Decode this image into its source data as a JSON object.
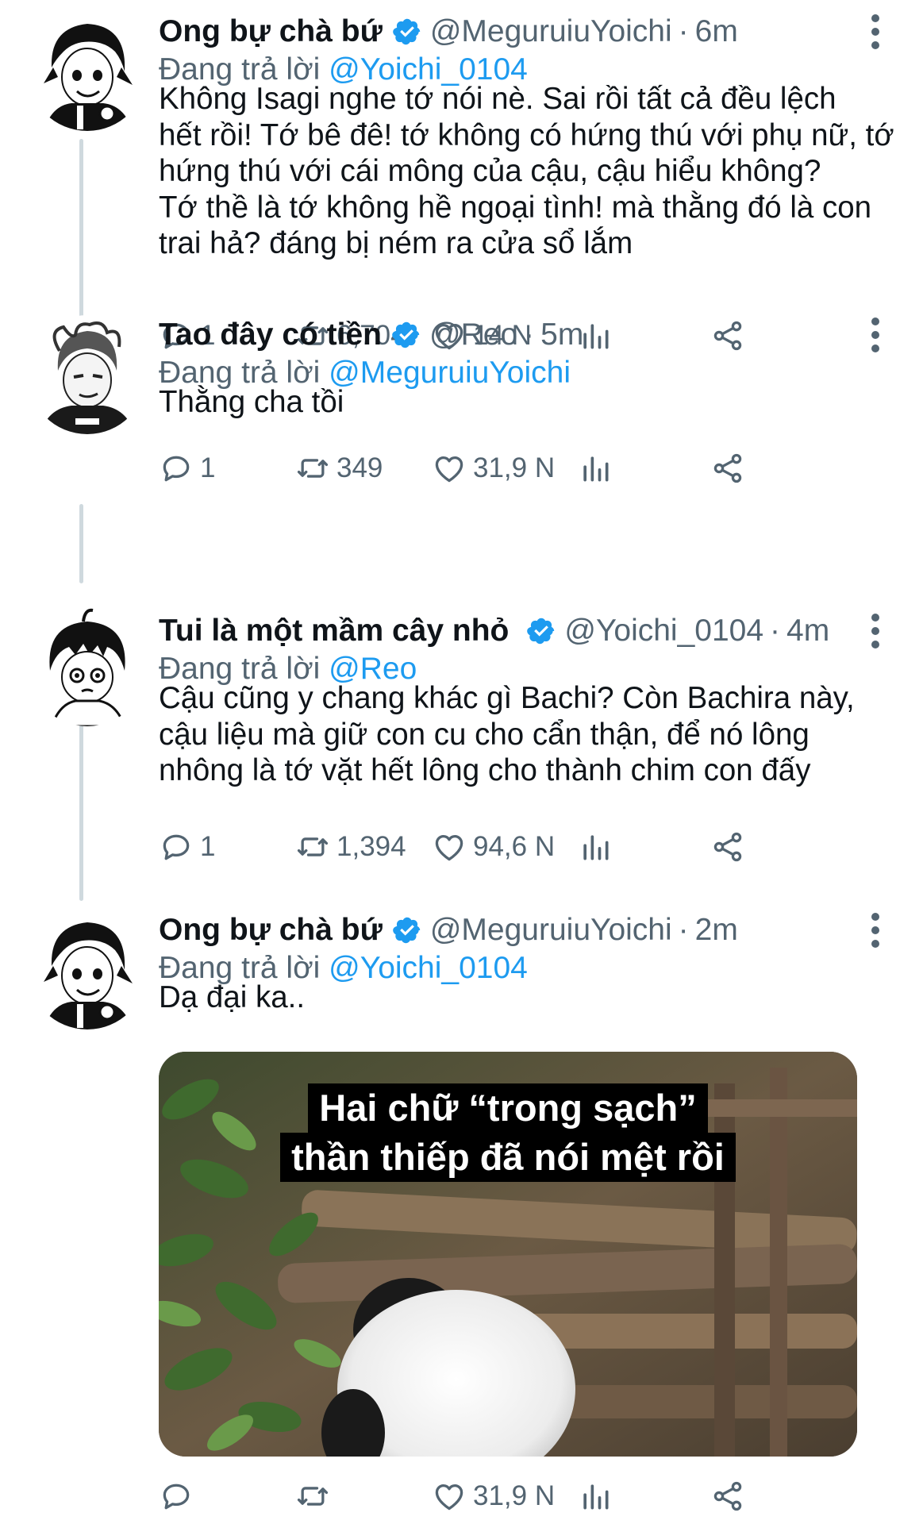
{
  "tweets": [
    {
      "display_name": "Ong bự chà bứ",
      "handle": "@MeguruiuYoichi",
      "time": "6m",
      "reply_prefix": "Đang trả lời",
      "reply_to": "@Yoichi_0104",
      "body": [
        "Không Isagi nghe tớ nói nè. Sai rồi tất cả đều lệch",
        "hết rồi! Tớ bê đê! tớ không có hứng thú với phụ nữ, tớ",
        "hứng thú với cái mông của cậu, cậu hiểu không?",
        "Tớ thề là tớ không hề ngoại tình! mà thằng đó là con",
        "trai hả? đáng bị ném ra cửa sổ lắm"
      ],
      "stats": {
        "replies": "1",
        "retweets": "6,704",
        "likes": "14 N"
      },
      "avatar_icon": "bachira-avatar"
    },
    {
      "display_name": "Tao đây có tiền",
      "handle": "@Reo",
      "time": "5m",
      "reply_prefix": "Đang trả lời",
      "reply_to": "@MeguruiuYoichi",
      "body": [
        "Thằng cha tồi"
      ],
      "stats": {
        "replies": "1",
        "retweets": "349",
        "likes": "31,9 N"
      },
      "avatar_icon": "reo-avatar"
    },
    {
      "display_name": "Tui là một mầm cây nhỏ",
      "handle": "@Yoichi_0104",
      "time": "4m",
      "reply_prefix": "Đang trả lời",
      "reply_to": "@Reo",
      "body": [
        "Cậu cũng y chang khác gì Bachi? Còn Bachira này,",
        "cậu liệu mà giữ con cu cho cẩn thận, để nó lông",
        "nhông là tớ vặt hết lông cho thành chim con đấy"
      ],
      "stats": {
        "replies": "1",
        "retweets": "1,394",
        "likes": "94,6 N"
      },
      "avatar_icon": "isagi-avatar"
    },
    {
      "display_name": "Ong bự chà bứ",
      "handle": "@MeguruiuYoichi",
      "time": "2m",
      "reply_prefix": "Đang trả lời",
      "reply_to": "@Yoichi_0104",
      "body": [
        "Dạ đại ka.."
      ],
      "media_caption": [
        "Hai chữ “trong sạch”",
        "thần thiếp đã nói mệt rồi"
      ],
      "stats": {
        "replies": "",
        "retweets": "",
        "likes": "31,9 N"
      },
      "avatar_icon": "bachira-avatar"
    }
  ],
  "icons": {
    "reply": "reply-icon",
    "retweet": "retweet-icon",
    "like": "heart-icon",
    "views": "views-icon",
    "share": "share-icon",
    "verified": "verified-badge-icon",
    "more": "more-icon"
  },
  "colors": {
    "accent": "#1d9bf0",
    "muted": "#536471",
    "text": "#0f1419"
  }
}
